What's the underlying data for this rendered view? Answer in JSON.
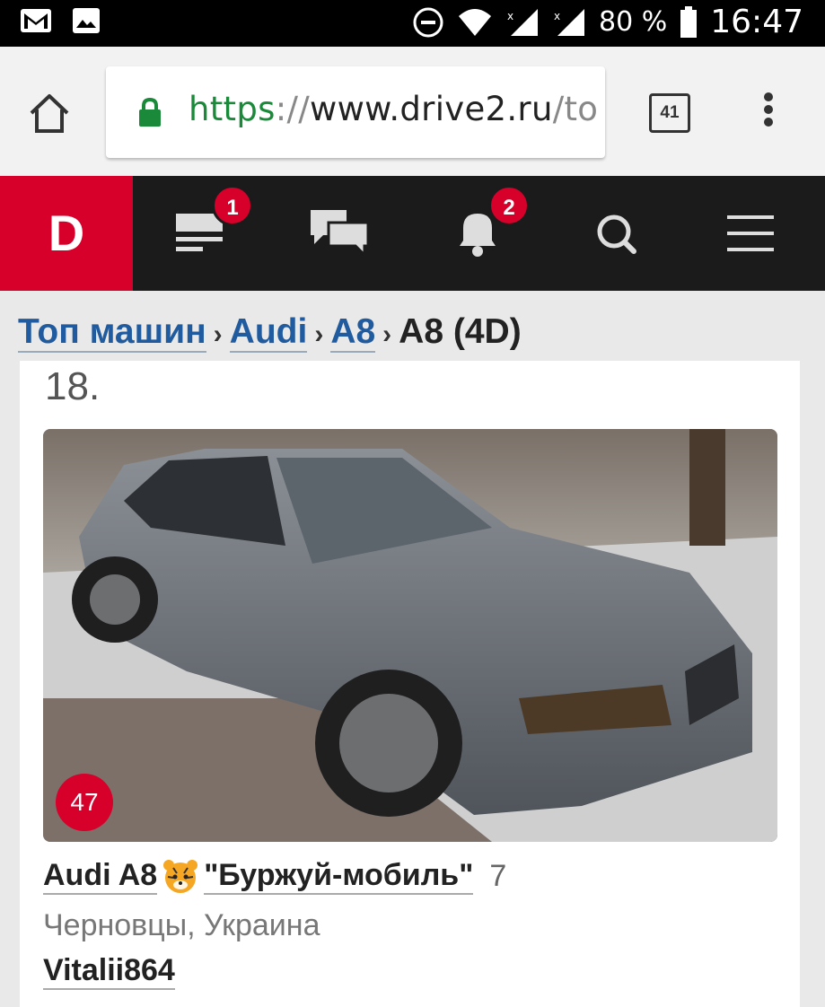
{
  "status_bar": {
    "battery_percent": "80 %",
    "time": "16:47",
    "icons": [
      "gmail-icon",
      "gallery-icon",
      "dnd-icon",
      "wifi-icon",
      "signal-icon",
      "signal-icon",
      "battery-icon"
    ]
  },
  "browser": {
    "url_scheme": "https",
    "url_sep": "://",
    "url_host": "www.drive2.ru",
    "url_rest": "/to",
    "tab_count": "41"
  },
  "site_nav": {
    "logo": "D",
    "feed_badge": "1",
    "notifications_badge": "2",
    "icons": [
      "feed-icon",
      "messages-icon",
      "bell-icon",
      "search-icon",
      "hamburger-icon"
    ]
  },
  "breadcrumb": {
    "item1": "Топ машин",
    "item2": "Audi",
    "item3": "A8",
    "current": "A8 (4D)",
    "separator": "›"
  },
  "card": {
    "rank": "18.",
    "likes": "47",
    "make_model": "Audi A8",
    "car_name": "\"Буржуй-мобиль\"",
    "count": "7",
    "location": "Черновцы, Украина",
    "owner": "Vitalii864"
  },
  "colors": {
    "brand_red": "#d6002b",
    "nav_bg": "#1b1b1b",
    "link_blue": "#1f5b9e",
    "secure_green": "#1a8a3a"
  }
}
